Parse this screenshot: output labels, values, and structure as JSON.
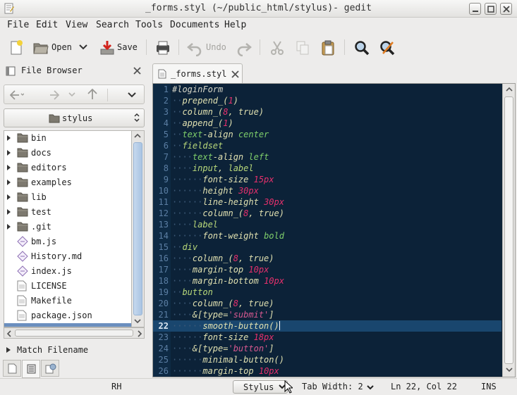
{
  "window": {
    "title": "_forms.styl (~/public_html/stylus)- gedit"
  },
  "menu": [
    "File",
    "Edit",
    "View",
    "Search",
    "Tools",
    "Documents",
    "Help"
  ],
  "toolbar": {
    "open_label": "Open",
    "save_label": "Save",
    "undo_label": "Undo"
  },
  "side_panel": {
    "title": "File Browser",
    "location": "stylus",
    "files": [
      {
        "name": "bin",
        "type": "folder"
      },
      {
        "name": "docs",
        "type": "folder"
      },
      {
        "name": "editors",
        "type": "folder"
      },
      {
        "name": "examples",
        "type": "folder"
      },
      {
        "name": "lib",
        "type": "folder"
      },
      {
        "name": "test",
        "type": "folder"
      },
      {
        "name": ".git",
        "type": "folder"
      },
      {
        "name": "bm.js",
        "type": "script"
      },
      {
        "name": "History.md",
        "type": "script"
      },
      {
        "name": "index.js",
        "type": "script"
      },
      {
        "name": "LICENSE",
        "type": "text"
      },
      {
        "name": "Makefile",
        "type": "text"
      },
      {
        "name": "package.json",
        "type": "text"
      }
    ],
    "match_label": "Match Filename"
  },
  "document": {
    "tab_label": "_forms.styl",
    "current_line": 22,
    "lines": [
      [
        [
          "sel",
          "#loginForm"
        ]
      ],
      [
        [
          "d",
          "··"
        ],
        [
          "prop",
          "prepend_("
        ],
        [
          "num",
          "1"
        ],
        [
          "prop",
          ")"
        ]
      ],
      [
        [
          "d",
          "··"
        ],
        [
          "prop",
          "column_("
        ],
        [
          "num",
          "8"
        ],
        [
          "prop",
          ", true)"
        ]
      ],
      [
        [
          "d",
          "··"
        ],
        [
          "prop",
          "append_("
        ],
        [
          "num",
          "1"
        ],
        [
          "prop",
          ")"
        ]
      ],
      [
        [
          "d",
          "··"
        ],
        [
          "ident",
          "text"
        ],
        [
          "prop",
          "-align "
        ],
        [
          "ident",
          "center"
        ]
      ],
      [
        [
          "d",
          "··"
        ],
        [
          "kw",
          "fieldset"
        ]
      ],
      [
        [
          "d",
          "····"
        ],
        [
          "ident",
          "text"
        ],
        [
          "prop",
          "-align "
        ],
        [
          "ident",
          "left"
        ]
      ],
      [
        [
          "d",
          "····"
        ],
        [
          "kw",
          "input"
        ],
        [
          "prop",
          ", "
        ],
        [
          "kw",
          "label"
        ]
      ],
      [
        [
          "d",
          "······"
        ],
        [
          "prop",
          "font-size "
        ],
        [
          "num",
          "15px"
        ]
      ],
      [
        [
          "d",
          "······"
        ],
        [
          "prop",
          "height "
        ],
        [
          "num",
          "30px"
        ]
      ],
      [
        [
          "d",
          "······"
        ],
        [
          "prop",
          "line-height "
        ],
        [
          "num",
          "30px"
        ]
      ],
      [
        [
          "d",
          "······"
        ],
        [
          "prop",
          "column_("
        ],
        [
          "num",
          "8"
        ],
        [
          "prop",
          ", true)"
        ]
      ],
      [
        [
          "d",
          "····"
        ],
        [
          "kw",
          "label"
        ]
      ],
      [
        [
          "d",
          "······"
        ],
        [
          "prop",
          "font-weight "
        ],
        [
          "ident",
          "bold"
        ]
      ],
      [
        [
          "d",
          "··"
        ],
        [
          "kw",
          "div"
        ]
      ],
      [
        [
          "d",
          "····"
        ],
        [
          "prop",
          "column_("
        ],
        [
          "num",
          "8"
        ],
        [
          "prop",
          ", true)"
        ]
      ],
      [
        [
          "d",
          "····"
        ],
        [
          "prop",
          "margin-top "
        ],
        [
          "num",
          "10px"
        ]
      ],
      [
        [
          "d",
          "····"
        ],
        [
          "prop",
          "margin-bottom "
        ],
        [
          "num",
          "10px"
        ]
      ],
      [
        [
          "d",
          "··"
        ],
        [
          "kw",
          "button"
        ]
      ],
      [
        [
          "d",
          "····"
        ],
        [
          "prop",
          "column_("
        ],
        [
          "num",
          "8"
        ],
        [
          "prop",
          ", true)"
        ]
      ],
      [
        [
          "d",
          "····"
        ],
        [
          "prop",
          "&[type="
        ],
        [
          "str",
          "'submit'"
        ],
        [
          "prop",
          "]"
        ]
      ],
      [
        [
          "d",
          "······"
        ],
        [
          "prop",
          "smooth-button()"
        ]
      ],
      [
        [
          "d",
          "······"
        ],
        [
          "prop",
          "font-size "
        ],
        [
          "num",
          "18px"
        ]
      ],
      [
        [
          "d",
          "····"
        ],
        [
          "prop",
          "&[type="
        ],
        [
          "str",
          "'button'"
        ],
        [
          "prop",
          "]"
        ]
      ],
      [
        [
          "d",
          "······"
        ],
        [
          "prop",
          "minimal-button()"
        ]
      ],
      [
        [
          "d",
          "······"
        ],
        [
          "prop",
          "margin-top "
        ],
        [
          "num",
          "10px"
        ]
      ]
    ]
  },
  "status": {
    "left": "RH",
    "language": "Stylus",
    "tab_width": "Tab Width: 2",
    "position": "Ln 22, Col 22",
    "mode": "INS"
  }
}
